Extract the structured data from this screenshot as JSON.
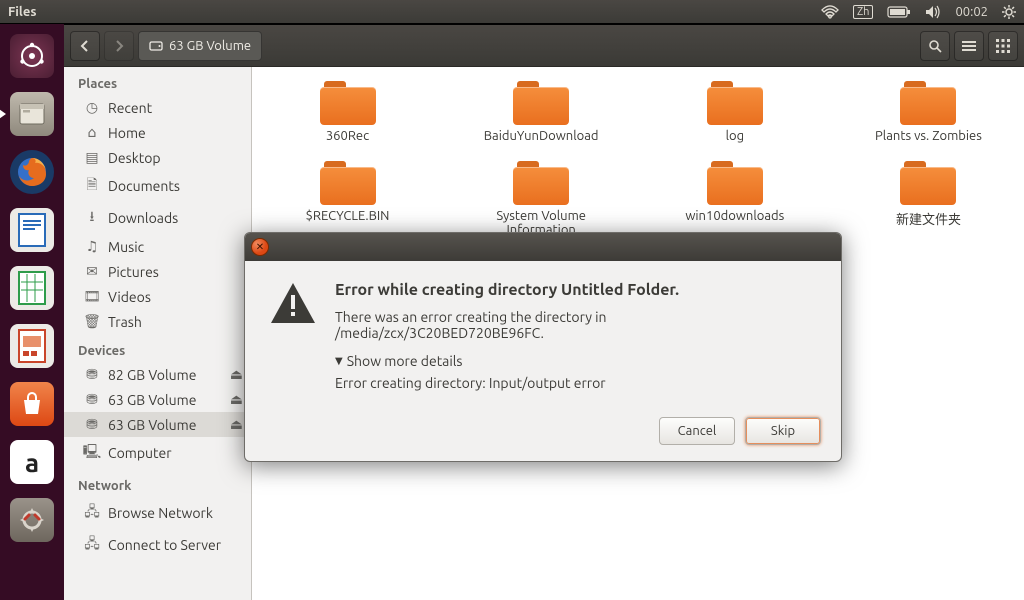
{
  "menubar": {
    "app_title": "Files",
    "ime": "Zh",
    "clock": "00:02"
  },
  "launcher": {
    "items": [
      {
        "name": "dash",
        "active": false
      },
      {
        "name": "files",
        "active": true
      },
      {
        "name": "firefox",
        "active": false
      },
      {
        "name": "writer",
        "active": false
      },
      {
        "name": "calc",
        "active": false
      },
      {
        "name": "impress",
        "active": false
      },
      {
        "name": "software",
        "active": false
      },
      {
        "name": "amazon",
        "active": false
      },
      {
        "name": "settings",
        "active": false
      }
    ]
  },
  "toolbar": {
    "location_label": "63 GB Volume"
  },
  "sidebar": {
    "places": {
      "heading": "Places",
      "items": [
        {
          "label": "Recent"
        },
        {
          "label": "Home"
        },
        {
          "label": "Desktop"
        },
        {
          "label": "Documents"
        },
        {
          "label": "Downloads"
        },
        {
          "label": "Music"
        },
        {
          "label": "Pictures"
        },
        {
          "label": "Videos"
        },
        {
          "label": "Trash"
        }
      ]
    },
    "devices": {
      "heading": "Devices",
      "items": [
        {
          "label": "82 GB Volume",
          "ejectable": true
        },
        {
          "label": "63 GB Volume",
          "ejectable": true
        },
        {
          "label": "63 GB Volume",
          "ejectable": true,
          "selected": true
        },
        {
          "label": "Computer"
        }
      ]
    },
    "network": {
      "heading": "Network",
      "items": [
        {
          "label": "Browse Network"
        },
        {
          "label": "Connect to Server"
        }
      ]
    }
  },
  "folders": [
    {
      "name": "360Rec"
    },
    {
      "name": "BaiduYunDownload"
    },
    {
      "name": "log"
    },
    {
      "name": "Plants vs. Zombies"
    },
    {
      "name": "$RECYCLE.BIN"
    },
    {
      "name": "System Volume Information"
    },
    {
      "name": "win10downloads"
    },
    {
      "name": "新建文件夹"
    }
  ],
  "dialog": {
    "title": "Error while creating directory Untitled Folder.",
    "message": "There was an error creating the directory in /media/zcx/3C20BED720BE96FC.",
    "disclosure_label": "Show more details",
    "detail": "Error creating directory: Input/output error",
    "cancel_label": "Cancel",
    "skip_label": "Skip"
  }
}
